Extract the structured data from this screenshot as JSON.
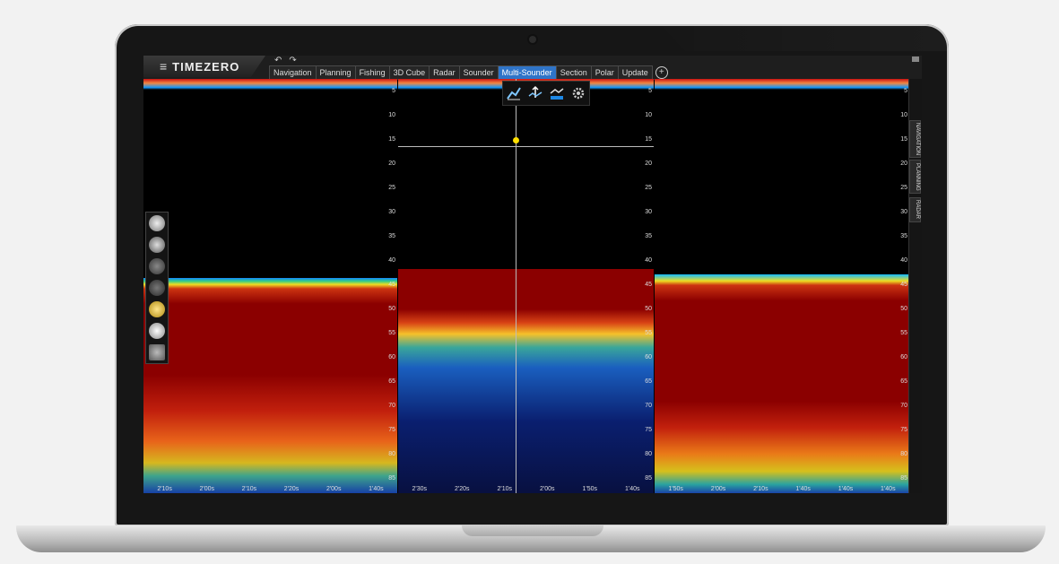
{
  "app": {
    "brand": "TIMEZERO",
    "menu_glyph": "≡",
    "undo_glyph": "↶",
    "redo_glyph": "↷"
  },
  "tabs": [
    {
      "label": "Navigation"
    },
    {
      "label": "Planning"
    },
    {
      "label": "Fishing"
    },
    {
      "label": "3D Cube"
    },
    {
      "label": "Radar"
    },
    {
      "label": "Sounder"
    },
    {
      "label": "Multi-Sounder",
      "active": true
    },
    {
      "label": "Section"
    },
    {
      "label": "Polar"
    },
    {
      "label": "Update"
    }
  ],
  "add_tab_glyph": "+",
  "depth_scale": [
    "5",
    "10",
    "15",
    "20",
    "25",
    "30",
    "35",
    "40",
    "45",
    "50",
    "55",
    "60",
    "65",
    "70",
    "75",
    "80",
    "85"
  ],
  "time_scale_left": [
    "2'10s",
    "2'00s",
    "2'10s",
    "2'20s",
    "2'00s",
    "1'40s"
  ],
  "time_scale_middle": [
    "2'30s",
    "2'20s",
    "2'10s",
    "2'00s",
    "1'50s",
    "1'40s"
  ],
  "time_scale_right": [
    "1'50s",
    "2'00s",
    "2'10s",
    "1'40s",
    "1'40s",
    "1'40s"
  ],
  "side_tabs": [
    "NAVIGATION",
    "PLANNING",
    "RADAR"
  ],
  "colors": {
    "accent_tab": "#2f74c8",
    "cursor_dot": "#ffe000",
    "seabed_red": "#8b0000"
  },
  "icons": {
    "center_tools": [
      "echo-trace-icon",
      "echo-range-icon",
      "echo-scale-icon",
      "settings-gear-icon"
    ],
    "left_tools": [
      "boat-icon",
      "transducer-icon",
      "gain-icon",
      "clutter-icon",
      "fish-icon",
      "bottom-lock-icon",
      "settings-gear-icon"
    ]
  }
}
